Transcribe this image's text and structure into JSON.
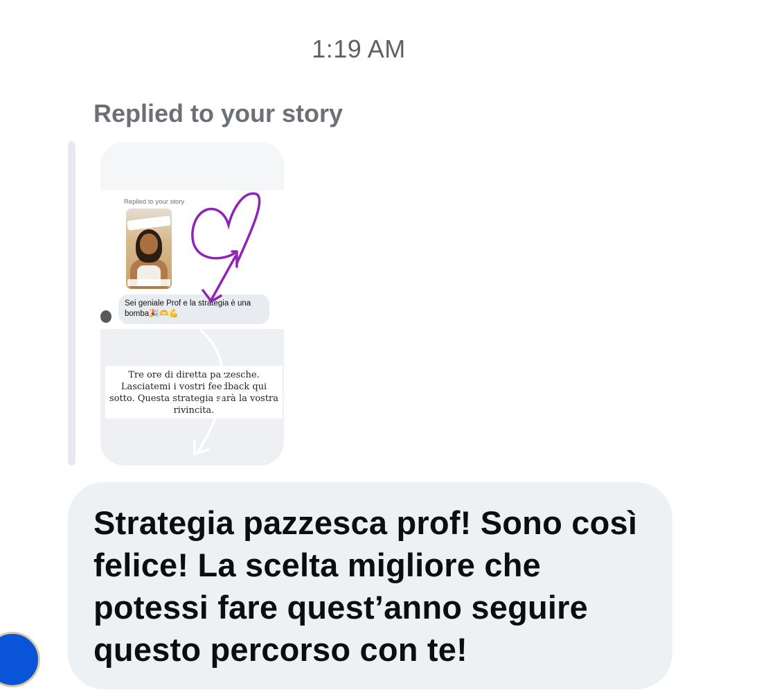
{
  "thread": {
    "timestamp": "1:19 AM",
    "reply_label": "Replied to your story"
  },
  "story_preview": {
    "inner_reply_label": "Replied to your story",
    "inner_message": "Sei geniale Prof e la strategia è una bomba🎉🫶💪",
    "caption": "Tre ore di diretta pazzesche. Lasciatemi i vostri feedback qui sotto. Questa strategia sarà la vostra rivincita.",
    "drawing_color": "#8f22b8"
  },
  "message": {
    "text": "Strategia pazzesca prof! Sono così felice! La scelta migliore che potessi fare quest’anno seguire questo percorso con te!",
    "bubble_color": "#eef1f4"
  },
  "sender": {
    "avatar_color": "#0a54d8"
  }
}
